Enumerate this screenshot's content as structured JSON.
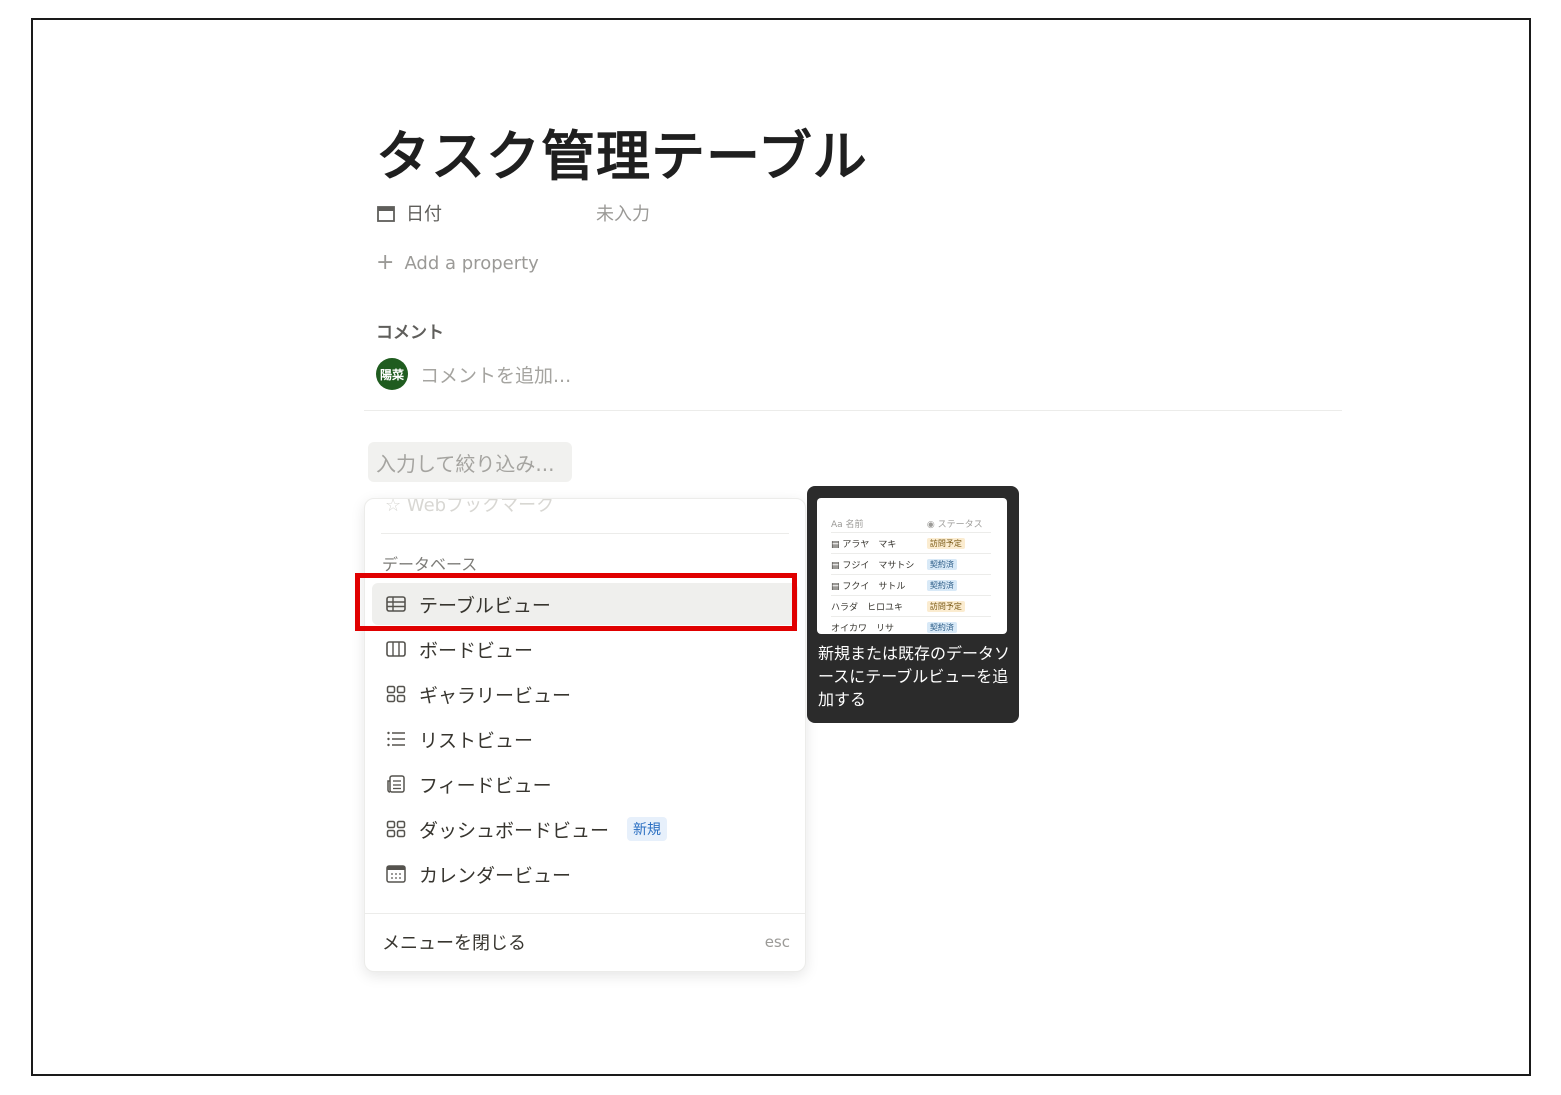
{
  "page": {
    "title": "タスク管理テーブル",
    "property": {
      "icon": "calendar-icon",
      "name": "日付",
      "value": "未入力"
    },
    "add_property": "Add a property",
    "comments": {
      "heading": "コメント",
      "avatar_text": "陽菜",
      "placeholder": "コメントを追加..."
    }
  },
  "filter": {
    "placeholder": "入力して絞り込み..."
  },
  "menu": {
    "faded_item": "Webブックマーク",
    "section": "データベース",
    "items": [
      {
        "label": "テーブルビュー",
        "icon": "table-icon",
        "selected": true
      },
      {
        "label": "ボードビュー",
        "icon": "board-icon"
      },
      {
        "label": "ギャラリービュー",
        "icon": "gallery-icon"
      },
      {
        "label": "リストビュー",
        "icon": "list-icon"
      },
      {
        "label": "フィードビュー",
        "icon": "feed-icon"
      },
      {
        "label": "ダッシュボードビュー",
        "icon": "dashboard-icon",
        "badge": "新規"
      },
      {
        "label": "カレンダービュー",
        "icon": "calendar-view-icon"
      }
    ],
    "close": {
      "label": "メニューを閉じる",
      "shortcut": "esc"
    }
  },
  "preview": {
    "columns": [
      "名前",
      "ステータス"
    ],
    "rows": [
      {
        "name": "アラヤ　マキ",
        "status": "訪問予定"
      },
      {
        "name": "フジイ　マサトシ",
        "status": "契約済"
      },
      {
        "name": "フクイ　サトル",
        "status": "契約済"
      },
      {
        "name": "ハラダ　ヒロユキ",
        "status": "訪問予定"
      },
      {
        "name": "オイカワ　リサ",
        "status": "契約済"
      }
    ],
    "description": "新規または既存のデータソースにテーブルビューを追加する"
  },
  "colors": {
    "highlight": "#e00000",
    "avatar": "#1f5c1f",
    "badge_text": "#2b6fc2"
  }
}
